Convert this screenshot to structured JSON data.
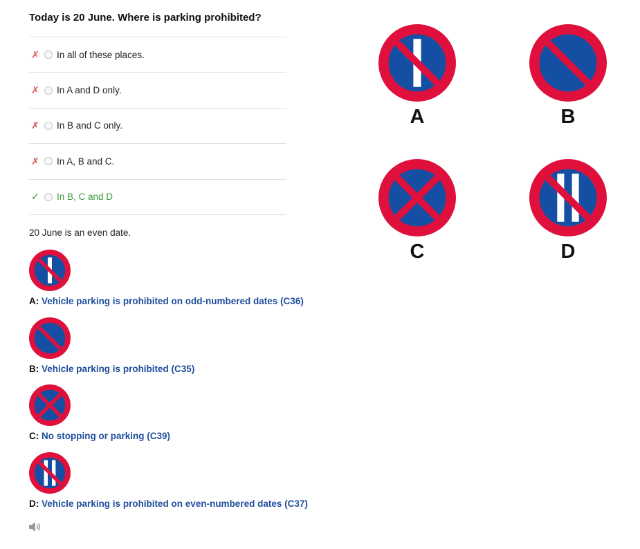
{
  "question": "Today is 20 June. Where is parking prohibited?",
  "answers": [
    {
      "mark": "✗",
      "text": "In all of these places.",
      "correct": false
    },
    {
      "mark": "✗",
      "text": "In A and D only.",
      "correct": false
    },
    {
      "mark": "✗",
      "text": "In B and C only.",
      "correct": false
    },
    {
      "mark": "✗",
      "text": "In A, B and C.",
      "correct": false
    },
    {
      "mark": "✓",
      "text": "In B, C and D",
      "correct": true
    }
  ],
  "explanation": "20 June is an even date.",
  "signs": [
    {
      "key": "A:",
      "desc": "Vehicle parking is prohibited on odd-numbered dates (C36)",
      "icon": "no-parking-odd-dates-sign"
    },
    {
      "key": "B:",
      "desc": "Vehicle parking is prohibited (C35)",
      "icon": "no-parking-sign"
    },
    {
      "key": "C:",
      "desc": "No stopping or parking (C39)",
      "icon": "no-stopping-sign"
    },
    {
      "key": "D:",
      "desc": "Vehicle parking is prohibited on even-numbered dates (C37)",
      "icon": "no-parking-even-dates-sign"
    }
  ],
  "big_signs": [
    {
      "label": "A"
    },
    {
      "label": "B"
    },
    {
      "label": "C"
    },
    {
      "label": "D"
    }
  ],
  "colors": {
    "sign_red": "#e0103c",
    "sign_blue": "#154fa3",
    "correct_green": "#3c9a3c",
    "wrong_red": "#d9534f",
    "link_blue": "#1f4e9c"
  },
  "icons": {
    "audio": "speaker-icon"
  }
}
